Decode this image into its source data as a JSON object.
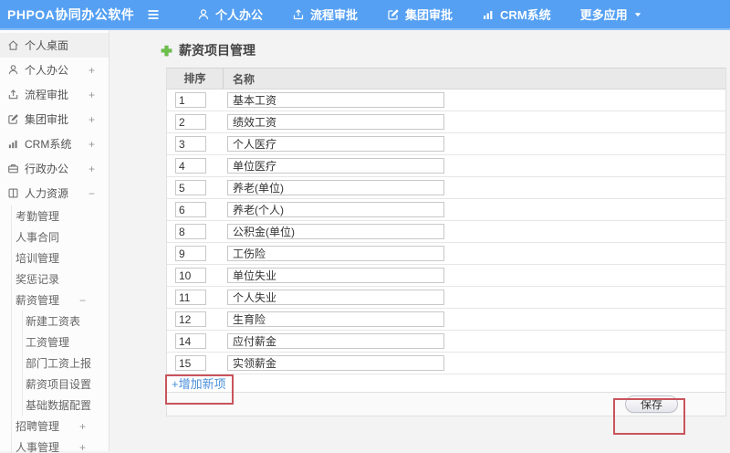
{
  "topbar": {
    "logo": "PHPOA协同办公软件",
    "hamburger_icon": "hamburger-icon",
    "menu": [
      {
        "id": "personal-office",
        "label": "个人办公",
        "icon": "user-icon"
      },
      {
        "id": "process-approval",
        "label": "流程审批",
        "icon": "process-icon"
      },
      {
        "id": "group-approval",
        "label": "集团审批",
        "icon": "edit-icon"
      },
      {
        "id": "crm-system",
        "label": "CRM系统",
        "icon": "chart-icon"
      },
      {
        "id": "more-apps",
        "label": "更多应用",
        "caret": "caret-down-icon"
      }
    ]
  },
  "sidebar": {
    "items": [
      {
        "id": "personal-desktop",
        "label": "个人桌面",
        "icon": "home-icon",
        "level": 1,
        "active": true
      },
      {
        "id": "personal-office",
        "label": "个人办公",
        "icon": "user-icon",
        "level": 1,
        "toggle": "+"
      },
      {
        "id": "process-approval",
        "label": "流程审批",
        "icon": "process-icon",
        "level": 1,
        "toggle": "+"
      },
      {
        "id": "group-approval",
        "label": "集团审批",
        "icon": "edit-icon",
        "level": 1,
        "toggle": "+"
      },
      {
        "id": "crm-system",
        "label": "CRM系统",
        "icon": "chart-icon",
        "level": 1,
        "toggle": "+"
      },
      {
        "id": "admin-office",
        "label": "行政办公",
        "icon": "briefcase-icon",
        "level": 1,
        "toggle": "+"
      },
      {
        "id": "hr",
        "label": "人力资源",
        "icon": "book-icon",
        "level": 1,
        "toggle": "−"
      },
      {
        "id": "attendance-mgmt",
        "label": "考勤管理",
        "level": 2
      },
      {
        "id": "hr-contract",
        "label": "人事合同",
        "level": 2
      },
      {
        "id": "training-mgmt",
        "label": "培训管理",
        "level": 2
      },
      {
        "id": "reward-records",
        "label": "奖惩记录",
        "level": 2
      },
      {
        "id": "salary-mgmt",
        "label": "薪资管理",
        "level": 2,
        "toggle": "−"
      },
      {
        "id": "new-payroll",
        "label": "新建工资表",
        "level": 3
      },
      {
        "id": "payroll-mgmt",
        "label": "工资管理",
        "level": 3
      },
      {
        "id": "dept-payroll-report",
        "label": "部门工资上报",
        "level": 3
      },
      {
        "id": "salary-item-settings",
        "label": "薪资项目设置",
        "level": 3
      },
      {
        "id": "base-data-config",
        "label": "基础数据配置",
        "level": 3
      },
      {
        "id": "recruit-mgmt",
        "label": "招聘管理",
        "level": 2,
        "toggle": "+"
      },
      {
        "id": "personnel-mgmt",
        "label": "人事管理",
        "level": 2,
        "toggle": "+"
      }
    ]
  },
  "main": {
    "title": "薪资项目管理",
    "title_icon": "plus-icon",
    "table": {
      "headers": [
        "排序",
        "名称"
      ],
      "rows": [
        {
          "order": "1",
          "name": "基本工资"
        },
        {
          "order": "2",
          "name": "绩效工资"
        },
        {
          "order": "3",
          "name": "个人医疗"
        },
        {
          "order": "4",
          "name": "单位医疗"
        },
        {
          "order": "5",
          "name": "养老(单位)"
        },
        {
          "order": "6",
          "name": "养老(个人)"
        },
        {
          "order": "8",
          "name": "公积金(单位)"
        },
        {
          "order": "9",
          "name": "工伤险"
        },
        {
          "order": "10",
          "name": "单位失业"
        },
        {
          "order": "11",
          "name": "个人失业"
        },
        {
          "order": "12",
          "name": "生育险"
        },
        {
          "order": "14",
          "name": "应付薪金"
        },
        {
          "order": "15",
          "name": "实领薪金"
        }
      ]
    },
    "add_link": "+增加新项",
    "save_label": "保存"
  },
  "colors": {
    "topbar_bg": "#55a0f2",
    "topbar_border": "#8abef5",
    "link_blue": "#4a90d9",
    "annotation_red": "#c9545c",
    "plus_green": "#6cc04a",
    "table_header_bg": "#e9e9e9"
  }
}
